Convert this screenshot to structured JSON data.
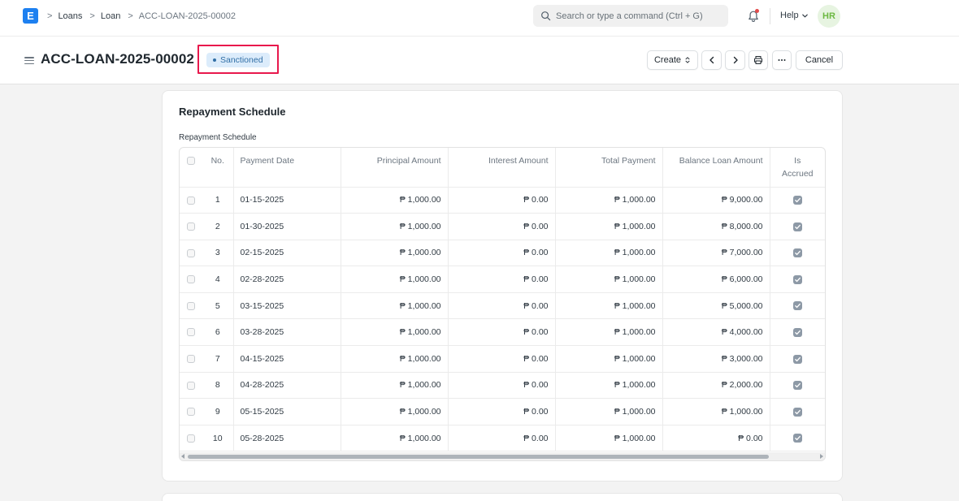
{
  "navbar": {
    "logo_letter": "E",
    "breadcrumbs": [
      "Loans",
      "Loan",
      "ACC-LOAN-2025-00002"
    ],
    "search_placeholder": "Search or type a command (Ctrl + G)",
    "help_label": "Help",
    "avatar_initials": "HR"
  },
  "page": {
    "title": "ACC-LOAN-2025-00002",
    "status": "Sanctioned",
    "create_label": "Create",
    "cancel_label": "Cancel"
  },
  "section": {
    "title": "Repayment Schedule",
    "field_label": "Repayment Schedule"
  },
  "table": {
    "headers": {
      "no": "No.",
      "payment_date": "Payment Date",
      "principal": "Principal Amount",
      "interest": "Interest Amount",
      "total": "Total Payment",
      "balance": "Balance Loan Amount",
      "accrued_line1": "Is",
      "accrued_line2": "Accrued"
    },
    "rows": [
      {
        "no": "1",
        "date": "01-15-2025",
        "principal": "₱ 1,000.00",
        "interest": "₱ 0.00",
        "total": "₱ 1,000.00",
        "balance": "₱ 9,000.00",
        "accrued": true
      },
      {
        "no": "2",
        "date": "01-30-2025",
        "principal": "₱ 1,000.00",
        "interest": "₱ 0.00",
        "total": "₱ 1,000.00",
        "balance": "₱ 8,000.00",
        "accrued": true
      },
      {
        "no": "3",
        "date": "02-15-2025",
        "principal": "₱ 1,000.00",
        "interest": "₱ 0.00",
        "total": "₱ 1,000.00",
        "balance": "₱ 7,000.00",
        "accrued": true
      },
      {
        "no": "4",
        "date": "02-28-2025",
        "principal": "₱ 1,000.00",
        "interest": "₱ 0.00",
        "total": "₱ 1,000.00",
        "balance": "₱ 6,000.00",
        "accrued": true
      },
      {
        "no": "5",
        "date": "03-15-2025",
        "principal": "₱ 1,000.00",
        "interest": "₱ 0.00",
        "total": "₱ 1,000.00",
        "balance": "₱ 5,000.00",
        "accrued": true
      },
      {
        "no": "6",
        "date": "03-28-2025",
        "principal": "₱ 1,000.00",
        "interest": "₱ 0.00",
        "total": "₱ 1,000.00",
        "balance": "₱ 4,000.00",
        "accrued": true
      },
      {
        "no": "7",
        "date": "04-15-2025",
        "principal": "₱ 1,000.00",
        "interest": "₱ 0.00",
        "total": "₱ 1,000.00",
        "balance": "₱ 3,000.00",
        "accrued": true
      },
      {
        "no": "8",
        "date": "04-28-2025",
        "principal": "₱ 1,000.00",
        "interest": "₱ 0.00",
        "total": "₱ 1,000.00",
        "balance": "₱ 2,000.00",
        "accrued": true
      },
      {
        "no": "9",
        "date": "05-15-2025",
        "principal": "₱ 1,000.00",
        "interest": "₱ 0.00",
        "total": "₱ 1,000.00",
        "balance": "₱ 1,000.00",
        "accrued": true
      },
      {
        "no": "10",
        "date": "05-28-2025",
        "principal": "₱ 1,000.00",
        "interest": "₱ 0.00",
        "total": "₱ 1,000.00",
        "balance": "₱ 0.00",
        "accrued": true
      }
    ]
  },
  "colors": {
    "brand": "#1d80f0",
    "status_bg": "#dcecfb",
    "status_text": "#316fa6",
    "highlight": "#e8184c"
  },
  "icons": [
    "search-icon",
    "bell-icon",
    "chevron-down-icon",
    "hamburger-icon",
    "sort-icon",
    "chevron-left-icon",
    "chevron-right-icon",
    "printer-icon",
    "more-icon",
    "checkmark-icon"
  ]
}
